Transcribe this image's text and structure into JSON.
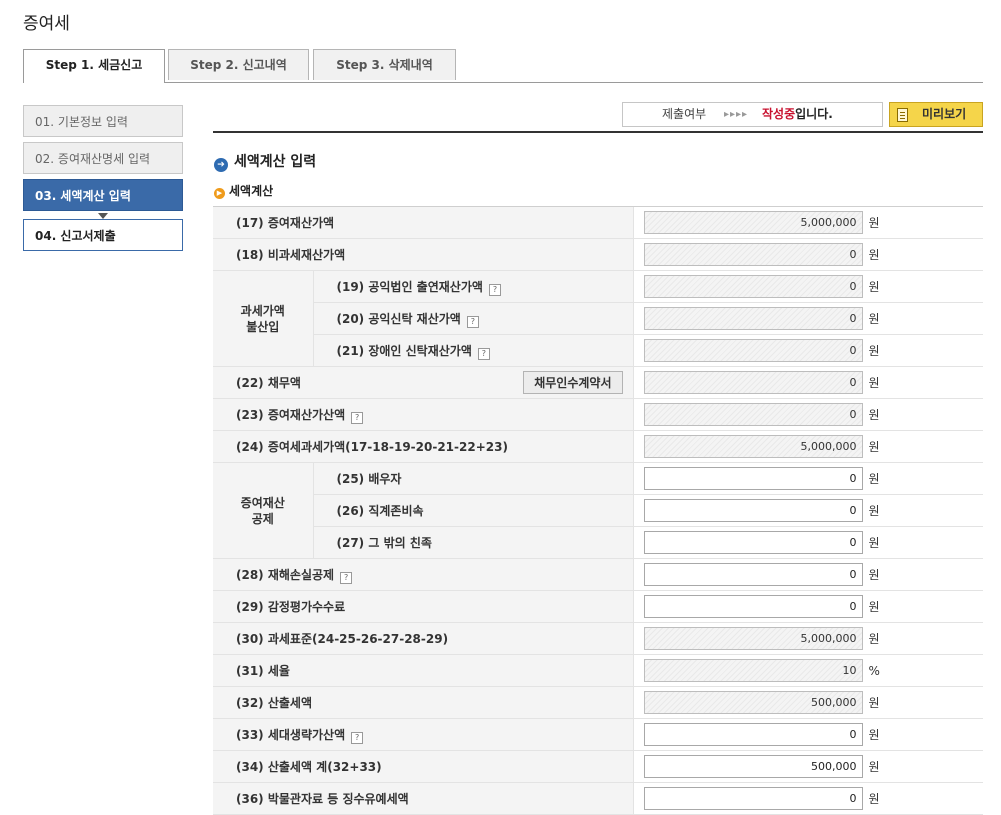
{
  "page_title": "증여세",
  "tabs": [
    {
      "label": "Step 1. 세금신고",
      "active": true
    },
    {
      "label": "Step 2. 신고내역",
      "active": false
    },
    {
      "label": "Step 3. 삭제내역",
      "active": false
    }
  ],
  "steps": [
    {
      "label": "01. 기본정보 입력"
    },
    {
      "label": "02. 증여재산명세 입력"
    },
    {
      "label": "03. 세액계산 입력"
    },
    {
      "label": "04. 신고서제출"
    }
  ],
  "status": {
    "label": "제출여부",
    "arrows": "▸▸▸▸",
    "value_highlight": "작성중",
    "value_suffix": "입니다."
  },
  "preview_label": "미리보기",
  "section_title": "세액계산 입력",
  "sub_title": "세액계산",
  "groups": {
    "exclusion": [
      "과세가액",
      "불산입"
    ],
    "deduction": [
      "증여재산",
      "공제"
    ]
  },
  "debt_contract_label": "채무인수계약서",
  "rows": {
    "r17": {
      "label": "(17) 증여재산가액",
      "value": "5,000,000",
      "unit": "원"
    },
    "r18": {
      "label": "(18) 비과세재산가액",
      "value": "0",
      "unit": "원"
    },
    "r19": {
      "label": "(19) 공익법인 출연재산가액",
      "value": "0",
      "unit": "원"
    },
    "r20": {
      "label": "(20) 공익신탁 재산가액",
      "value": "0",
      "unit": "원"
    },
    "r21": {
      "label": "(21) 장애인 신탁재산가액",
      "value": "0",
      "unit": "원"
    },
    "r22": {
      "label": "(22) 채무액",
      "value": "0",
      "unit": "원"
    },
    "r23": {
      "label": "(23) 증여재산가산액",
      "value": "0",
      "unit": "원"
    },
    "r24": {
      "label": "(24) 증여세과세가액(17-18-19-20-21-22+23)",
      "value": "5,000,000",
      "unit": "원"
    },
    "r25": {
      "label": "(25) 배우자",
      "value": "0",
      "unit": "원"
    },
    "r26": {
      "label": "(26) 직계존비속",
      "value": "0",
      "unit": "원"
    },
    "r27": {
      "label": "(27) 그 밖의 친족",
      "value": "0",
      "unit": "원"
    },
    "r28": {
      "label": "(28) 재해손실공제",
      "value": "0",
      "unit": "원"
    },
    "r29": {
      "label": "(29) 감정평가수수료",
      "value": "0",
      "unit": "원"
    },
    "r30": {
      "label": "(30) 과세표준(24-25-26-27-28-29)",
      "value": "5,000,000",
      "unit": "원"
    },
    "r31": {
      "label": "(31) 세율",
      "value": "10",
      "unit": "%"
    },
    "r32": {
      "label": "(32) 산출세액",
      "value": "500,000",
      "unit": "원"
    },
    "r33": {
      "label": "(33) 세대생략가산액",
      "value": "0",
      "unit": "원"
    },
    "r34": {
      "label": "(34) 산출세액 계(32+33)",
      "value": "500,000",
      "unit": "원"
    },
    "r36": {
      "label": "(36) 박물관자료 등 징수유예세액",
      "value": "0",
      "unit": "원"
    }
  }
}
